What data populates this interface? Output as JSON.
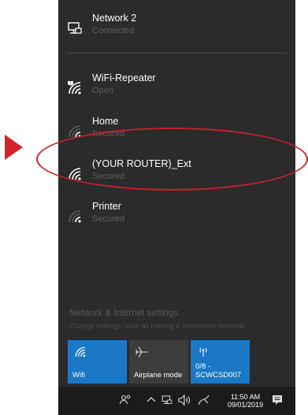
{
  "networks": [
    {
      "name": "Network 2",
      "status": "Connected",
      "icon": "ethernet-icon"
    },
    {
      "name": "WiFi-Repeater",
      "status": "Open",
      "icon": "wifi-open-icon"
    },
    {
      "name": "Home",
      "status": "Secured",
      "icon": "wifi-secured-icon"
    },
    {
      "name": "(YOUR ROUTER)_Ext",
      "status": "Secured",
      "icon": "wifi-secured-icon"
    },
    {
      "name": "Printer",
      "status": "Secured",
      "icon": "wifi-secured-icon"
    }
  ],
  "settings": {
    "title": "Network & Internet settings",
    "subtitle": "Change settings, such as making a connection metered."
  },
  "quick_actions": {
    "wifi": {
      "label": "Wifi",
      "icon": "wifi-icon",
      "color": "#1a78c7"
    },
    "airplane": {
      "label": "Airplane mode",
      "icon": "airplane-icon",
      "color": "#3c3c3c"
    },
    "hotspot": {
      "label_line1": "0/8 -",
      "label_line2": "SCWCSD007",
      "icon": "hotspot-icon",
      "color": "#1a78c7"
    }
  },
  "taskbar": {
    "time": "11:50 AM",
    "date": "09/01/2019"
  },
  "colors": {
    "panel_bg": "#2b2b2b",
    "accent": "#1a78c7",
    "highlight": "#c8202a"
  }
}
